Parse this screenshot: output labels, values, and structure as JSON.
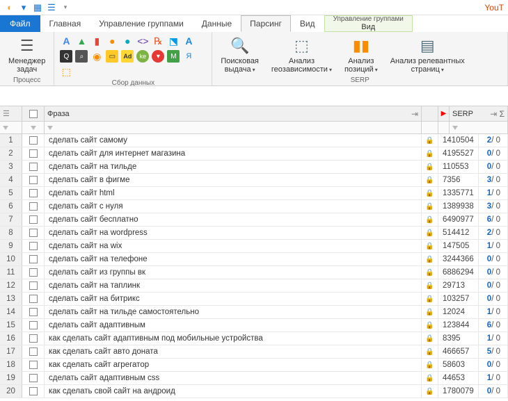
{
  "titlebar": {
    "right_text": "YouT"
  },
  "menu": {
    "file": "Файл",
    "tabs": [
      "Главная",
      "Управление группами",
      "Данные",
      "Парсинг",
      "Вид"
    ],
    "active_tab": "Парсинг",
    "context_group": "Управление группами",
    "context_sub": "Вид"
  },
  "ribbon": {
    "process": {
      "label": "Процесс",
      "manager_label": "Менеджер",
      "manager_sub": "задач"
    },
    "data": {
      "label": "Сбор данных"
    },
    "serp": {
      "label": "SERP",
      "btns": [
        {
          "label": "Поисковая",
          "sub": "выдача"
        },
        {
          "label": "Анализ",
          "sub": "геозависимости"
        },
        {
          "label": "Анализ",
          "sub": "позиций"
        },
        {
          "label": "Анализ релевантных",
          "sub": "страниц"
        }
      ]
    }
  },
  "columns": {
    "phrase": "Фраза",
    "serp": "SERP"
  },
  "rows": [
    {
      "n": 1,
      "phrase": "сделать сайт самому",
      "c1": "1410504",
      "a": 2,
      "b": 0
    },
    {
      "n": 2,
      "phrase": "сделать сайт для интернет магазина",
      "c1": "4195527",
      "a": 0,
      "b": 0
    },
    {
      "n": 3,
      "phrase": "сделать сайт на тильде",
      "c1": "110553",
      "a": 0,
      "b": 0
    },
    {
      "n": 4,
      "phrase": "сделать сайт в фигме",
      "c1": "7356",
      "a": 3,
      "b": 0
    },
    {
      "n": 5,
      "phrase": "сделать сайт html",
      "c1": "1335771",
      "a": 1,
      "b": 0
    },
    {
      "n": 6,
      "phrase": "сделать сайт с нуля",
      "c1": "1389938",
      "a": 3,
      "b": 0
    },
    {
      "n": 7,
      "phrase": "сделать сайт бесплатно",
      "c1": "6490977",
      "a": 6,
      "b": 0
    },
    {
      "n": 8,
      "phrase": "сделать сайт на wordpress",
      "c1": "514412",
      "a": 2,
      "b": 0
    },
    {
      "n": 9,
      "phrase": "сделать сайт на wix",
      "c1": "147505",
      "a": 1,
      "b": 0
    },
    {
      "n": 10,
      "phrase": "сделать сайт на телефоне",
      "c1": "3244366",
      "a": 0,
      "b": 0
    },
    {
      "n": 11,
      "phrase": "сделать сайт из группы вк",
      "c1": "6886294",
      "a": 0,
      "b": 0
    },
    {
      "n": 12,
      "phrase": "сделать сайт на таплинк",
      "c1": "29713",
      "a": 0,
      "b": 0
    },
    {
      "n": 13,
      "phrase": "сделать сайт на битрикс",
      "c1": "103257",
      "a": 0,
      "b": 0
    },
    {
      "n": 14,
      "phrase": "сделать сайт на тильде самостоятельно",
      "c1": "12024",
      "a": 1,
      "b": 0
    },
    {
      "n": 15,
      "phrase": "сделать сайт адаптивным",
      "c1": "123844",
      "a": 6,
      "b": 0
    },
    {
      "n": 16,
      "phrase": "как сделать сайт адаптивным под мобильные устройства",
      "c1": "8395",
      "a": 1,
      "b": 0
    },
    {
      "n": 17,
      "phrase": "как сделать сайт авто доната",
      "c1": "466657",
      "a": 5,
      "b": 0
    },
    {
      "n": 18,
      "phrase": "как сделать сайт агрегатор",
      "c1": "58603",
      "a": 0,
      "b": 0
    },
    {
      "n": 19,
      "phrase": "сделать сайт адаптивным css",
      "c1": "44653",
      "a": 1,
      "b": 0
    },
    {
      "n": 20,
      "phrase": "как сделать свой сайт на андроид",
      "c1": "1780079",
      "a": 0,
      "b": 0
    }
  ]
}
